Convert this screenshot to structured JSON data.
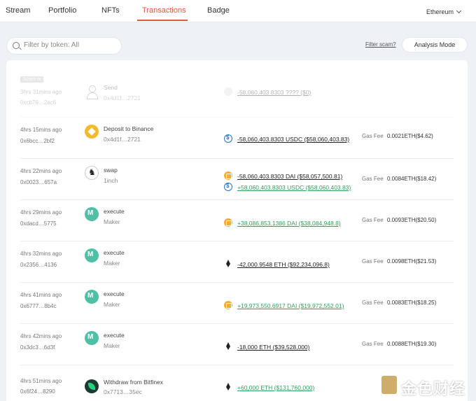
{
  "nav": {
    "tabs": [
      {
        "label": "Stream"
      },
      {
        "label": "Portfolio"
      },
      {
        "label": "NFTs"
      },
      {
        "label": "Transactions",
        "active": true
      },
      {
        "label": "Badge"
      }
    ],
    "network": "Ethereum"
  },
  "filter": {
    "placeholder": "Filter by token: All",
    "scam_link": "Filter scam?",
    "analysis_button": "Analysis Mode"
  },
  "fee_label": "Gas Fee",
  "scam_tag": "Scam tx",
  "transactions": [
    {
      "scam": true,
      "time": "3hrs 31mins ago",
      "hash": "0xcb79…2ac6",
      "action": "Send",
      "counterparty": "0x4d1f…2721",
      "icon": "person-icon",
      "tokens": [
        {
          "icon": "ghost-token-icon",
          "amount": "-58,060,403.8303 ???? ($0)",
          "direction": "out"
        }
      ]
    },
    {
      "time": "4hrs 15mins ago",
      "hash": "0x6bcc…2bf2",
      "action": "Deposit to Binance",
      "counterparty": "0x4d1f…2721",
      "icon": "binance-icon",
      "tokens": [
        {
          "icon": "usdc-icon",
          "amount": "-58,060,403.8303 USDC ($58,060,403.83)",
          "direction": "out"
        }
      ],
      "fee": "0.0021ETH($4.62)"
    },
    {
      "time": "4hrs 22mins ago",
      "hash": "0x0023…657a",
      "action": "swap",
      "counterparty": "1inch",
      "icon": "unicorn-icon",
      "tokens": [
        {
          "icon": "dai-icon",
          "amount": "-58,060,403.8303 DAI ($58,057,500.81)",
          "direction": "out"
        },
        {
          "icon": "usdc-icon",
          "amount": "+58,060,403.8303 USDC ($58,060,403.83)",
          "direction": "in"
        }
      ],
      "fee": "0.0084ETH($18.42)"
    },
    {
      "time": "4hrs 29mins ago",
      "hash": "0xdacd…5775",
      "action": "execute",
      "counterparty": "Maker",
      "icon": "maker-icon",
      "tokens": [
        {
          "icon": "dai-icon",
          "amount": "+38,086,853.1386 DAI ($38,084,948.8)",
          "direction": "in"
        }
      ],
      "fee": "0.0093ETH($20.50)"
    },
    {
      "time": "4hrs 32mins ago",
      "hash": "0x2356…4136",
      "action": "execute",
      "counterparty": "Maker",
      "icon": "maker-icon",
      "tokens": [
        {
          "icon": "eth-icon",
          "amount": "-42,000.9548 ETH ($92,234,096.8)",
          "direction": "out"
        }
      ],
      "fee": "0.0098ETH($21.53)"
    },
    {
      "time": "4hrs 41mins ago",
      "hash": "0x6777…8b4c",
      "action": "execute",
      "counterparty": "Maker",
      "icon": "maker-icon",
      "tokens": [
        {
          "icon": "dai-icon",
          "amount": "+19,973,550.6917 DAI ($19,972,552.01)",
          "direction": "in"
        }
      ],
      "fee": "0.0083ETH($18.25)"
    },
    {
      "time": "4hrs 42mins ago",
      "hash": "0x3dc3…6d3f",
      "action": "execute",
      "counterparty": "Maker",
      "icon": "maker-icon",
      "tokens": [
        {
          "icon": "eth-icon",
          "amount": "-18,000 ETH ($39,528,000)",
          "direction": "out"
        }
      ],
      "fee": "0.0088ETH($19.30)"
    },
    {
      "time": "4hrs 51mins ago",
      "hash": "0x6f24…8290",
      "action": "Withdraw from Bitfinex",
      "counterparty": "0x7713…35ec",
      "icon": "bitfinex-icon",
      "tokens": [
        {
          "icon": "eth-icon",
          "amount": "+60,000 ETH ($131,760,000)",
          "direction": "in"
        }
      ]
    }
  ],
  "watermark": {
    "text": "金色财经",
    "icon": "jinse-logo-icon"
  },
  "colors": {
    "accent": "#e0583c",
    "positive": "#32a05b",
    "background": "#eef1f5"
  }
}
